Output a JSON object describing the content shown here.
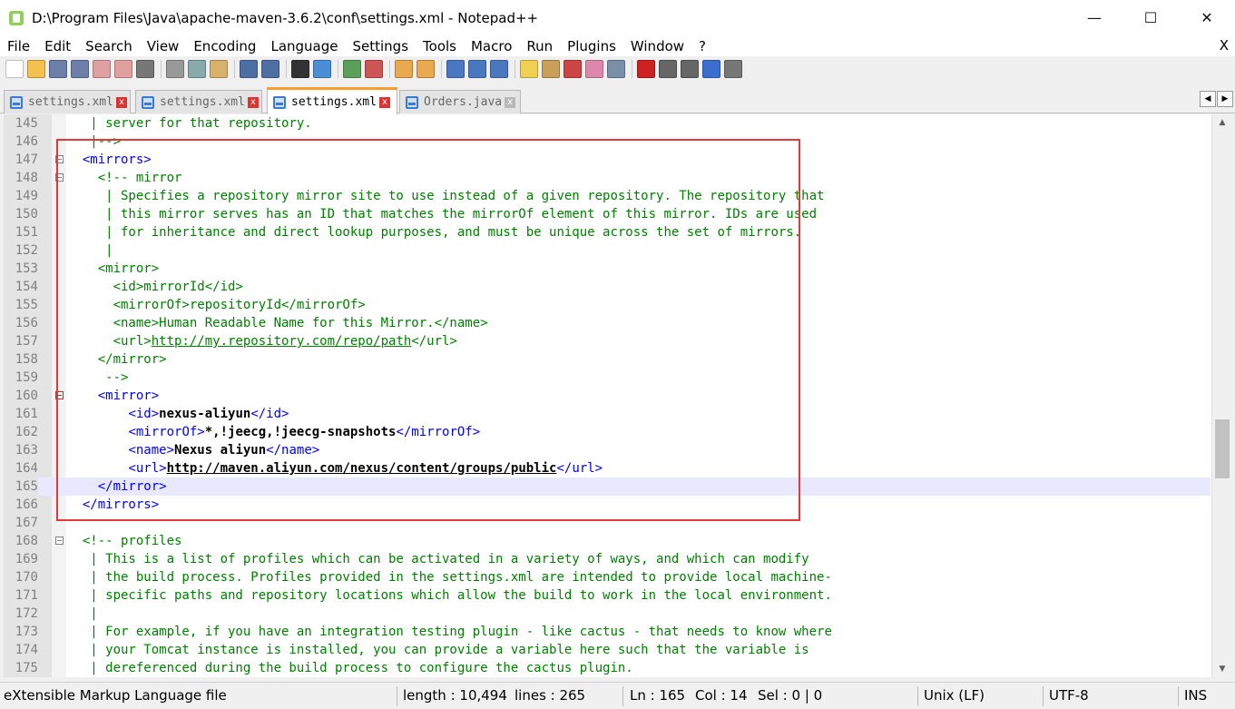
{
  "window": {
    "title": "D:\\Program Files\\Java\\apache-maven-3.6.2\\conf\\settings.xml - Notepad++",
    "minimize_glyph": "—",
    "maximize_glyph": "☐",
    "close_glyph": "✕"
  },
  "menu": {
    "items": [
      "File",
      "Edit",
      "Search",
      "View",
      "Encoding",
      "Language",
      "Settings",
      "Tools",
      "Macro",
      "Run",
      "Plugins",
      "Window",
      "?"
    ],
    "close_glyph": "X"
  },
  "toolbar": {
    "icons": [
      "new-file-icon",
      "open-file-icon",
      "save-icon",
      "save-all-icon",
      "close-icon",
      "close-all-icon",
      "print-icon",
      "cut-icon",
      "copy-icon",
      "paste-icon",
      "undo-icon",
      "redo-icon",
      "find-icon",
      "replace-icon",
      "zoom-in-icon",
      "zoom-out-icon",
      "sync-vertical-icon",
      "sync-horizontal-icon",
      "word-wrap-icon",
      "show-all-chars-icon",
      "indent-guide-icon",
      "user-language-icon",
      "doc-map-icon",
      "function-list-icon",
      "folder-workspace-icon",
      "monitoring-icon",
      "record-macro-icon",
      "stop-record-icon",
      "play-macro-icon",
      "run-macro-multiple-icon",
      "save-macro-icon"
    ]
  },
  "tabs": [
    {
      "label": "settings.xml",
      "active": false
    },
    {
      "label": "settings.xml",
      "active": false
    },
    {
      "label": "settings.xml",
      "active": true
    },
    {
      "label": "Orders.java",
      "active": false
    }
  ],
  "tab_close_glyph": "x",
  "tab_arrows": {
    "left": "◀",
    "right": "▶"
  },
  "scroll": {
    "up": "▲",
    "down": "▼"
  },
  "editor": {
    "lines": [
      {
        "n": "145",
        "fold": "",
        "segs": [
          [
            "cm",
            "   | server for that repository."
          ]
        ]
      },
      {
        "n": "146",
        "fold": "",
        "segs": [
          [
            "cm",
            "   |-->"
          ]
        ]
      },
      {
        "n": "147",
        "fold": "box",
        "segs": [
          [
            "tx",
            "  "
          ],
          [
            "tg",
            "<mirrors>"
          ]
        ]
      },
      {
        "n": "148",
        "fold": "box",
        "segs": [
          [
            "tx",
            "    "
          ],
          [
            "cm",
            "<!-- mirror"
          ]
        ]
      },
      {
        "n": "149",
        "fold": "",
        "segs": [
          [
            "cm",
            "     | Specifies a repository mirror site to use instead of a given repository. The repository that"
          ]
        ]
      },
      {
        "n": "150",
        "fold": "",
        "segs": [
          [
            "cm",
            "     | this mirror serves has an ID that matches the mirrorOf element of this mirror. IDs are used"
          ]
        ]
      },
      {
        "n": "151",
        "fold": "",
        "segs": [
          [
            "cm",
            "     | for inheritance and direct lookup purposes, and must be unique across the set of mirrors."
          ]
        ]
      },
      {
        "n": "152",
        "fold": "",
        "segs": [
          [
            "cm",
            "     |"
          ]
        ]
      },
      {
        "n": "153",
        "fold": "",
        "segs": [
          [
            "cm",
            "    <mirror>"
          ]
        ]
      },
      {
        "n": "154",
        "fold": "",
        "segs": [
          [
            "cm",
            "      <id>mirrorId</id>"
          ]
        ]
      },
      {
        "n": "155",
        "fold": "",
        "segs": [
          [
            "cm",
            "      <mirrorOf>repositoryId</mirrorOf>"
          ]
        ]
      },
      {
        "n": "156",
        "fold": "",
        "segs": [
          [
            "cm",
            "      <name>Human Readable Name for this Mirror.</name>"
          ]
        ]
      },
      {
        "n": "157",
        "fold": "",
        "segs": [
          [
            "cm",
            "      <url>"
          ],
          [
            "cm ul",
            "http://my.repository.com/repo/path"
          ],
          [
            "cm",
            "</url>"
          ]
        ]
      },
      {
        "n": "158",
        "fold": "",
        "segs": [
          [
            "cm",
            "    </mirror>"
          ]
        ]
      },
      {
        "n": "159",
        "fold": "",
        "segs": [
          [
            "cm",
            "     -->"
          ]
        ]
      },
      {
        "n": "160",
        "fold": "red",
        "segs": [
          [
            "tx",
            "    "
          ],
          [
            "tg",
            "<mirror>"
          ]
        ]
      },
      {
        "n": "161",
        "fold": "",
        "segs": [
          [
            "tx",
            "        "
          ],
          [
            "tg",
            "<id>"
          ],
          [
            "bd",
            "nexus-aliyun"
          ],
          [
            "tg",
            "</id>"
          ]
        ]
      },
      {
        "n": "162",
        "fold": "",
        "segs": [
          [
            "tx",
            "        "
          ],
          [
            "tg",
            "<mirrorOf>"
          ],
          [
            "bd",
            "*,!jeecg,!jeecg-snapshots"
          ],
          [
            "tg",
            "</mirrorOf>"
          ]
        ]
      },
      {
        "n": "163",
        "fold": "",
        "segs": [
          [
            "tx",
            "        "
          ],
          [
            "tg",
            "<name>"
          ],
          [
            "bd",
            "Nexus aliyun"
          ],
          [
            "tg",
            "</name>"
          ]
        ]
      },
      {
        "n": "164",
        "fold": "",
        "segs": [
          [
            "tx",
            "        "
          ],
          [
            "tg",
            "<url>"
          ],
          [
            "bd ul",
            "http://maven.aliyun.com/nexus/content/groups/public"
          ],
          [
            "tg",
            "</url>"
          ]
        ]
      },
      {
        "n": "165",
        "fold": "",
        "current": true,
        "segs": [
          [
            "tx",
            "    "
          ],
          [
            "tg",
            "</mirror>"
          ]
        ]
      },
      {
        "n": "166",
        "fold": "",
        "segs": [
          [
            "tx",
            "  "
          ],
          [
            "tg",
            "</mirrors>"
          ]
        ]
      },
      {
        "n": "167",
        "fold": "",
        "segs": [
          [
            "tx",
            ""
          ]
        ]
      },
      {
        "n": "168",
        "fold": "box",
        "segs": [
          [
            "tx",
            "  "
          ],
          [
            "cm",
            "<!-- profiles"
          ]
        ]
      },
      {
        "n": "169",
        "fold": "",
        "segs": [
          [
            "cm",
            "   | This is a list of profiles which can be activated in a variety of ways, and which can modify"
          ]
        ]
      },
      {
        "n": "170",
        "fold": "",
        "segs": [
          [
            "cm",
            "   | the build process. Profiles provided in the settings.xml are intended to provide local machine-"
          ]
        ]
      },
      {
        "n": "171",
        "fold": "",
        "segs": [
          [
            "cm",
            "   | specific paths and repository locations which allow the build to work in the local environment."
          ]
        ]
      },
      {
        "n": "172",
        "fold": "",
        "segs": [
          [
            "cm",
            "   |"
          ]
        ]
      },
      {
        "n": "173",
        "fold": "",
        "segs": [
          [
            "cm",
            "   | For example, if you have an integration testing plugin - like cactus - that needs to know where"
          ]
        ]
      },
      {
        "n": "174",
        "fold": "",
        "segs": [
          [
            "cm",
            "   | your Tomcat instance is installed, you can provide a variable here such that the variable is"
          ]
        ]
      },
      {
        "n": "175",
        "fold": "",
        "segs": [
          [
            "cm",
            "   | dereferenced during the build process to configure the cactus plugin."
          ]
        ]
      }
    ]
  },
  "status": {
    "filetype": "eXtensible Markup Language file",
    "length": "length : 10,494",
    "lines": "lines : 265",
    "ln": "Ln : 165",
    "col": "Col : 14",
    "sel": "Sel : 0 | 0",
    "eol": "Unix (LF)",
    "encoding": "UTF-8",
    "mode": "INS"
  }
}
